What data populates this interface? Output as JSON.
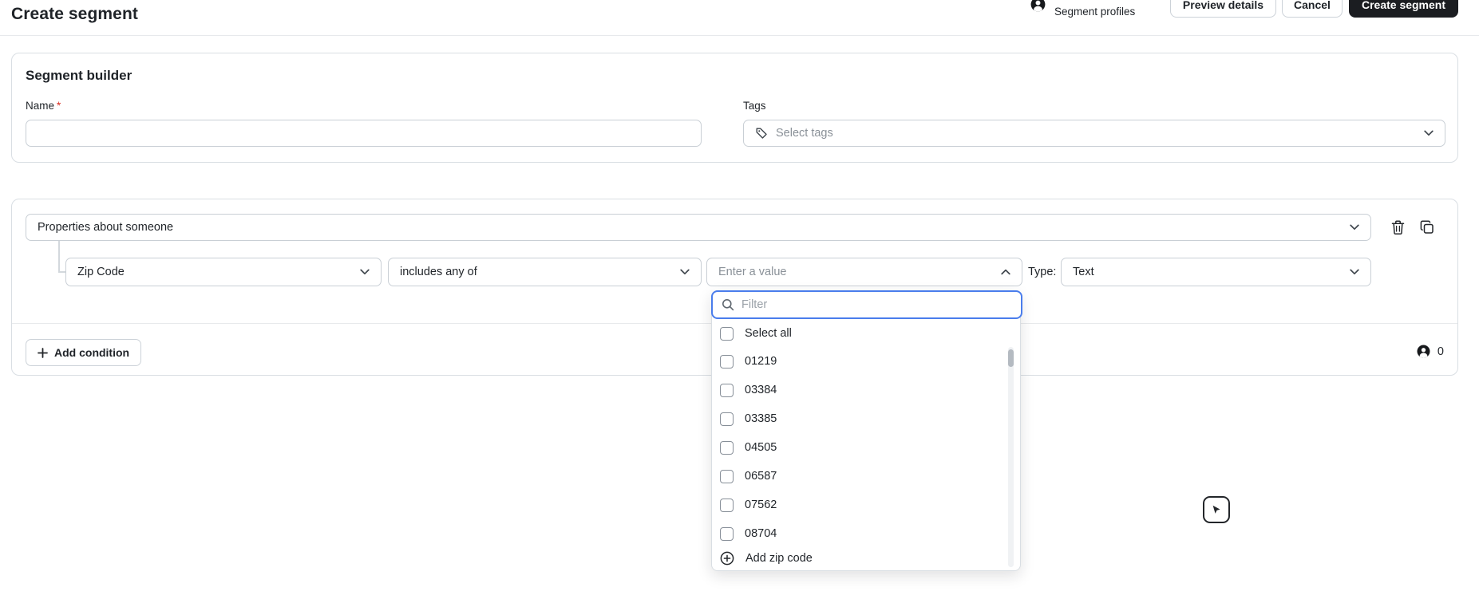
{
  "page_title": "Create segment",
  "header": {
    "segment_profiles_label": "Segment profiles",
    "preview_button": "Preview details",
    "cancel_button": "Cancel",
    "create_button": "Create segment"
  },
  "segment_builder": {
    "heading": "Segment builder",
    "name": {
      "label": "Name",
      "required_marker": "*",
      "value": ""
    },
    "tags": {
      "label": "Tags",
      "placeholder": "Select tags"
    }
  },
  "definition": {
    "subject_select": "Properties about someone",
    "property_select": "Zip Code",
    "operator_select": "includes any of",
    "value_placeholder": "Enter a value",
    "type_label": "Type:",
    "type_select": "Text",
    "add_condition_button": "Add condition",
    "profile_count": "0"
  },
  "value_dropdown": {
    "filter_placeholder": "Filter",
    "select_all_label": "Select all",
    "options": [
      "01219",
      "03384",
      "03385",
      "04505",
      "06587",
      "07562",
      "08704"
    ],
    "add_option_label": "Add zip code"
  },
  "colors": {
    "accent_blue": "#4a7dec",
    "dark_button": "#1b1d21",
    "field_border": "#c9cfd5",
    "card_border": "#d9dee3",
    "text": "#1f2328",
    "muted": "#8a9198",
    "required_red": "#d92d20"
  },
  "icons": [
    "profile-icon",
    "tag-icon",
    "chevron-down-icon",
    "chevron-up-icon",
    "trash-icon",
    "copy-icon",
    "search-icon",
    "plus-icon",
    "plus-circle-icon",
    "cursor-widget-icon"
  ]
}
